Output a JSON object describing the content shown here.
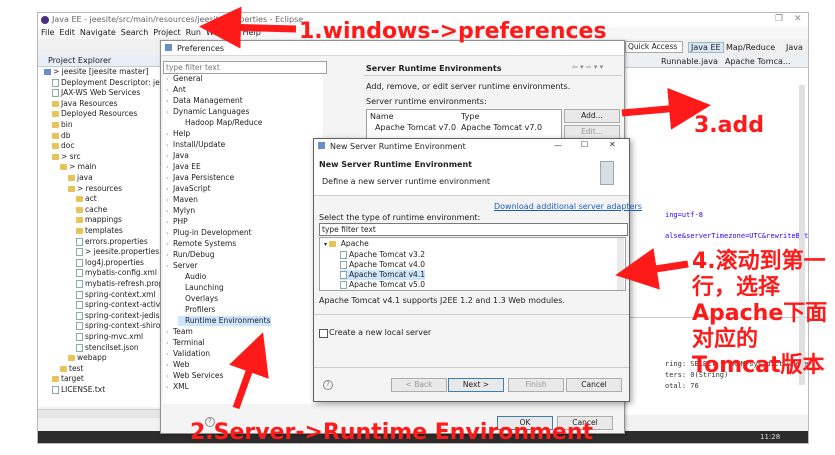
{
  "eclipse": {
    "title": "Java EE - jeesite/src/main/resources/jeesite.properties - Eclipse",
    "menu": [
      "File",
      "Edit",
      "Navigate",
      "Search",
      "Project",
      "Run",
      "Window",
      "Help"
    ],
    "quick_access": "Quick Access",
    "perspectives": [
      "Java EE",
      "Map/Reduce",
      "Java"
    ]
  },
  "project_explorer": {
    "title": "Project Explorer",
    "items": [
      {
        "label": "> jeesite  [jeesite master]",
        "depth": 0,
        "icon": "proj"
      },
      {
        "label": "Deployment Descriptor: jeesite",
        "depth": 1,
        "icon": "file"
      },
      {
        "label": "JAX-WS Web Services",
        "depth": 1,
        "icon": "file"
      },
      {
        "label": "Java Resources",
        "depth": 1,
        "icon": "folder"
      },
      {
        "label": "Deployed Resources",
        "depth": 1,
        "icon": "folder"
      },
      {
        "label": "bin",
        "depth": 1,
        "icon": "folder"
      },
      {
        "label": "db",
        "depth": 1,
        "icon": "folder"
      },
      {
        "label": "doc",
        "depth": 1,
        "icon": "folder"
      },
      {
        "label": "> src",
        "depth": 1,
        "icon": "folder"
      },
      {
        "label": "> main",
        "depth": 2,
        "icon": "folder"
      },
      {
        "label": "java",
        "depth": 3,
        "icon": "folder"
      },
      {
        "label": "> resources",
        "depth": 3,
        "icon": "folder"
      },
      {
        "label": "act",
        "depth": 4,
        "icon": "folder"
      },
      {
        "label": "cache",
        "depth": 4,
        "icon": "folder"
      },
      {
        "label": "mappings",
        "depth": 4,
        "icon": "folder"
      },
      {
        "label": "templates",
        "depth": 4,
        "icon": "folder"
      },
      {
        "label": "errors.properties",
        "depth": 4,
        "icon": "file"
      },
      {
        "label": "> jeesite.properties",
        "depth": 4,
        "icon": "file"
      },
      {
        "label": "log4j.properties",
        "depth": 4,
        "icon": "file"
      },
      {
        "label": "mybatis-config.xml",
        "depth": 4,
        "icon": "file"
      },
      {
        "label": "mybatis-refresh.properties",
        "depth": 4,
        "icon": "file"
      },
      {
        "label": "spring-context.xml",
        "depth": 4,
        "icon": "file"
      },
      {
        "label": "spring-context-activiti.xml",
        "depth": 4,
        "icon": "file"
      },
      {
        "label": "spring-context-jedis.xml",
        "depth": 4,
        "icon": "file"
      },
      {
        "label": "spring-context-shiro.xml",
        "depth": 4,
        "icon": "file"
      },
      {
        "label": "spring-mvc.xml",
        "depth": 4,
        "icon": "file"
      },
      {
        "label": "stencilset.json",
        "depth": 4,
        "icon": "file"
      },
      {
        "label": "webapp",
        "depth": 3,
        "icon": "folder"
      },
      {
        "label": "test",
        "depth": 2,
        "icon": "folder"
      },
      {
        "label": "target",
        "depth": 1,
        "icon": "folder"
      },
      {
        "label": "LICENSE.txt",
        "depth": 1,
        "icon": "file"
      }
    ]
  },
  "editor": {
    "tabs": [
      "Runnable.java",
      "Apache Tomca..."
    ],
    "code_lines": [
      "ing=utf-8",
      "alse&serverTimezone=UTC&rewriteBat"
    ],
    "console_lines": [
      "ring: SELECT * FROM sys_dict where",
      "ters: 0(String)",
      "otal: 76"
    ],
    "status_time": "11:28"
  },
  "preferences": {
    "title": "Preferences",
    "filter_placeholder": "type filter text",
    "tree": [
      {
        "label": "General",
        "depth": 0
      },
      {
        "label": "Ant",
        "depth": 0
      },
      {
        "label": "Data Management",
        "depth": 0
      },
      {
        "label": "Dynamic Languages",
        "depth": 0
      },
      {
        "label": "Hadoop Map/Reduce",
        "depth": 1
      },
      {
        "label": "Help",
        "depth": 0
      },
      {
        "label": "Install/Update",
        "depth": 0
      },
      {
        "label": "Java",
        "depth": 0
      },
      {
        "label": "Java EE",
        "depth": 0
      },
      {
        "label": "Java Persistence",
        "depth": 0
      },
      {
        "label": "JavaScript",
        "depth": 0
      },
      {
        "label": "Maven",
        "depth": 0
      },
      {
        "label": "Mylyn",
        "depth": 0
      },
      {
        "label": "PHP",
        "depth": 0
      },
      {
        "label": "Plug-in Development",
        "depth": 0
      },
      {
        "label": "Remote Systems",
        "depth": 0
      },
      {
        "label": "Run/Debug",
        "depth": 0
      },
      {
        "label": "Server",
        "depth": 0
      },
      {
        "label": "Audio",
        "depth": 1
      },
      {
        "label": "Launching",
        "depth": 1
      },
      {
        "label": "Overlays",
        "depth": 1
      },
      {
        "label": "Profilers",
        "depth": 1
      },
      {
        "label": "Runtime Environments",
        "depth": 1,
        "selected": true
      },
      {
        "label": "Team",
        "depth": 0
      },
      {
        "label": "Terminal",
        "depth": 0
      },
      {
        "label": "Validation",
        "depth": 0
      },
      {
        "label": "Web",
        "depth": 0
      },
      {
        "label": "Web Services",
        "depth": 0
      },
      {
        "label": "XML",
        "depth": 0
      }
    ],
    "page_title": "Server Runtime Environments",
    "description": "Add, remove, or edit server runtime environments.",
    "list_label": "Server runtime environments:",
    "table_headers": [
      "Name",
      "Type"
    ],
    "table_rows": [
      [
        "Apache Tomcat v7.0",
        "Apache Tomcat v7.0"
      ]
    ],
    "add_button": "Add...",
    "edit_button": "Edit...",
    "ok_button": "OK",
    "cancel_button": "Cancel"
  },
  "new_server": {
    "title": "New Server Runtime Environment",
    "header_title": "New Server Runtime Environment",
    "header_desc": "Define a new server runtime environment",
    "download_link": "Download additional server adapters",
    "select_label": "Select the type of runtime environment:",
    "filter_value": "type filter text",
    "group": "Apache",
    "options": [
      "Apache Tomcat v3.2",
      "Apache Tomcat v4.0",
      "Apache Tomcat v4.1",
      "Apache Tomcat v5.0"
    ],
    "selected_option": "Apache Tomcat v4.1",
    "support_text": "Apache Tomcat v4.1 supports J2EE 1.2 and 1.3 Web modules.",
    "checkbox_label": "Create a new local server",
    "back_button": "< Back",
    "next_button": "Next >",
    "finish_button": "Finish",
    "cancel_button": "Cancel"
  },
  "annotations": {
    "step1": "1.windows->preferences",
    "step2": "2.Server->Runtime Environment",
    "step3": "3.add",
    "step4": "4.滚动到第一行，选择Apache下面对应的Tomcat版本",
    "color": "#ff1a1a"
  }
}
